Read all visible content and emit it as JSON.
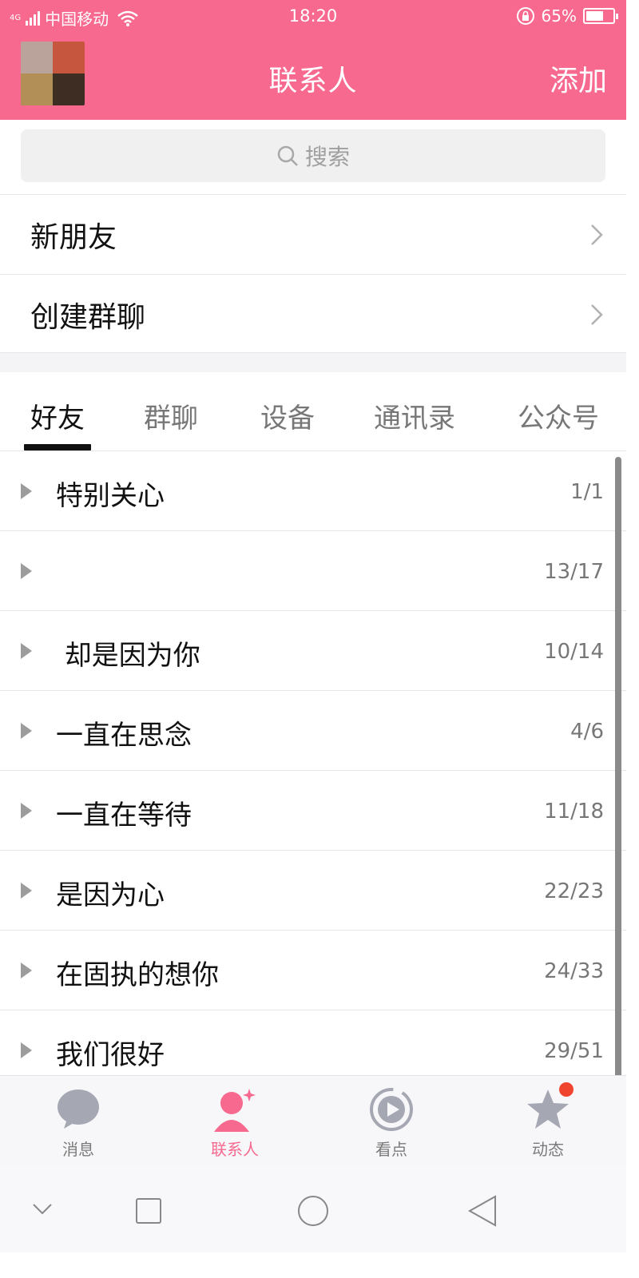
{
  "status": {
    "network": "4G",
    "carrier": "中国移动",
    "time": "18:20",
    "battery": "65%",
    "battery_level": 0.65
  },
  "header": {
    "title": "联系人",
    "add_label": "添加"
  },
  "search": {
    "placeholder": "搜索"
  },
  "entries": [
    {
      "label": "新朋友"
    },
    {
      "label": "创建群聊"
    }
  ],
  "tabs": [
    {
      "label": "好友",
      "active": true
    },
    {
      "label": "群聊",
      "active": false
    },
    {
      "label": "设备",
      "active": false
    },
    {
      "label": "通讯录",
      "active": false
    },
    {
      "label": "公众号",
      "active": false
    }
  ],
  "groups": [
    {
      "name": "特别关心",
      "count": "1/1"
    },
    {
      "name": "",
      "count": "13/17"
    },
    {
      "name": " 却是因为你",
      "count": "10/14"
    },
    {
      "name": "一直在思念",
      "count": "4/6"
    },
    {
      "name": "一直在等待",
      "count": "11/18"
    },
    {
      "name": "是因为心",
      "count": "22/23"
    },
    {
      "name": "在固执的想你",
      "count": "24/33"
    },
    {
      "name": "我们很好",
      "count": "29/51"
    }
  ],
  "bottom_nav": [
    {
      "label": "消息",
      "icon": "chat-bubble-icon",
      "active": false
    },
    {
      "label": "联系人",
      "icon": "contact-person-icon",
      "active": true
    },
    {
      "label": "看点",
      "icon": "play-circle-icon",
      "active": false
    },
    {
      "label": "动态",
      "icon": "star-icon",
      "active": false,
      "badge": true
    }
  ],
  "colors": {
    "brand": "#f7698e",
    "badge": "#f0442f"
  }
}
